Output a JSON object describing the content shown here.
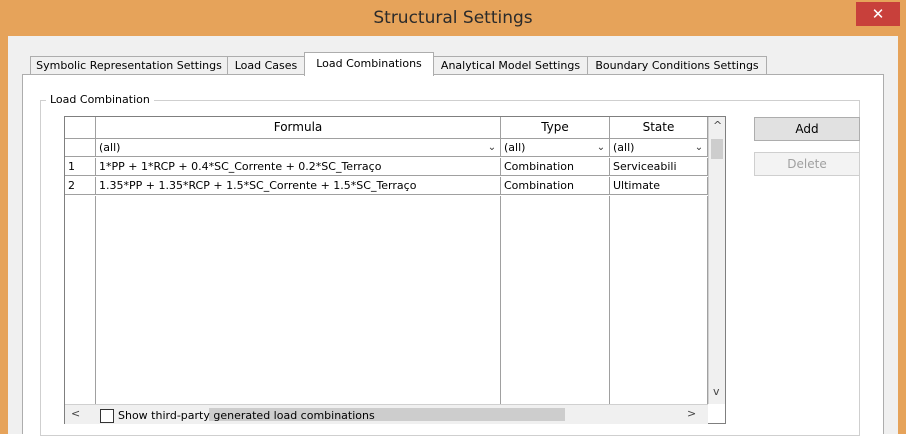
{
  "window": {
    "title": "Structural Settings",
    "close_glyph": "✕",
    "colors": {
      "titlebar": "#e6a35a",
      "close": "#c8403b"
    }
  },
  "tabs": [
    {
      "label": "Symbolic Representation Settings",
      "active": false
    },
    {
      "label": "Load Cases",
      "active": false
    },
    {
      "label": "Load Combinations",
      "active": true
    },
    {
      "label": "Analytical Model Settings",
      "active": false
    },
    {
      "label": "Boundary Conditions Settings",
      "active": false
    }
  ],
  "group": {
    "label": "Load Combination"
  },
  "grid": {
    "columns": [
      "",
      "Formula",
      "Type",
      "State"
    ],
    "filters": {
      "formula": "(all)",
      "type": "(all)",
      "state": "(all)"
    },
    "rows": [
      {
        "num": "1",
        "formula": "1*PP + 1*RCP + 0.4*SC_Corrente + 0.2*SC_Terraço",
        "type": "Combination",
        "state": "Serviceabili"
      },
      {
        "num": "2",
        "formula": "1.35*PP + 1.35*RCP + 1.5*SC_Corrente + 1.5*SC_Terraço",
        "type": "Combination",
        "state": "Ultimate"
      }
    ],
    "scroll_up": "^",
    "scroll_down": "v",
    "scroll_left": "<",
    "scroll_right": ">"
  },
  "buttons": {
    "add": "Add",
    "delete": "Delete"
  },
  "checkbox": {
    "label": "Show third-party generated load combinations",
    "checked": false
  }
}
